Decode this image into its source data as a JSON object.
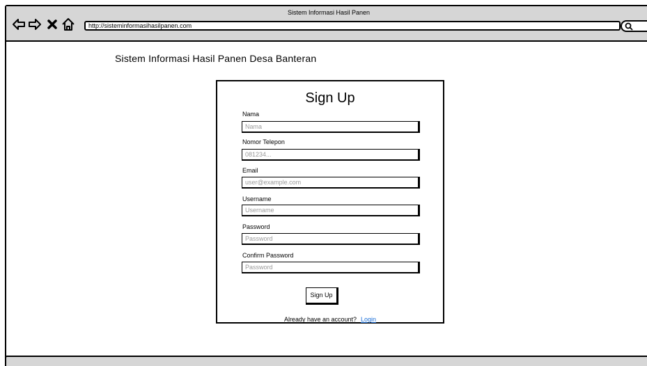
{
  "browser": {
    "window_title": "Sistem Informasi Hasil Panen",
    "url": "http://sisteminformasihasilpanen.com",
    "nav_icons": [
      "back-arrow-icon",
      "forward-arrow-icon",
      "close-x-icon",
      "home-icon"
    ],
    "search_icon": "search-icon"
  },
  "page": {
    "title": "Sistem Informasi Hasil Panen Desa Banteran"
  },
  "form": {
    "heading": "Sign Up",
    "fields": [
      {
        "label": "Nama",
        "placeholder": "Nama"
      },
      {
        "label": "Nomor Telepon",
        "placeholder": "081234..."
      },
      {
        "label": "Email",
        "placeholder": "user@example.com"
      },
      {
        "label": "Username",
        "placeholder": "Username"
      },
      {
        "label": "Password",
        "placeholder": "Password"
      },
      {
        "label": "Confirm Password",
        "placeholder": "Password"
      }
    ],
    "submit_label": "Sign Up",
    "footer_text": "Already have an account?",
    "login_link": "Login"
  },
  "colors": {
    "chrome": "#d6d6d6",
    "link": "#1a6fd9",
    "placeholder": "#9a9a9a"
  }
}
